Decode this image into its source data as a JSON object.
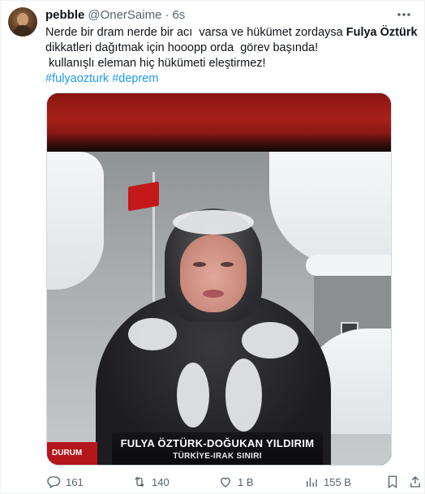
{
  "user": {
    "display_name": "pebble",
    "handle": "@OnerSaime",
    "separator": "·",
    "timestamp": "6s"
  },
  "tweet": {
    "lines": [
      "Nerde bir dram nerde bir acı  varsa ve hükümet zordaysa ",
      "dikkatleri dağıtmak için hooopp orda  görev başında!",
      " kullanışlı eleman hiç hükümeti eleştirmez!"
    ],
    "bold_name": "Fulya Öztürk",
    "hashtags": [
      "#fulyaozturk",
      "#deprem"
    ]
  },
  "media": {
    "lower_third_name": "FULYA ÖZTÜRK-DOĞUKAN YILDIRIM",
    "lower_third_place": "TÜRKİYE-IRAK SINIRI",
    "corner_label": "DURUM"
  },
  "actions": {
    "replies": "161",
    "retweets": "140",
    "likes": "1 B",
    "views": "155 B"
  },
  "icons": {
    "more": "more-icon",
    "reply": "reply-icon",
    "retweet": "retweet-icon",
    "like": "heart-icon",
    "views": "views-icon",
    "bookmark": "bookmark-icon",
    "share": "share-icon"
  },
  "colors": {
    "link": "#1d9bf0",
    "muted": "#536471",
    "text": "#0f1419"
  }
}
